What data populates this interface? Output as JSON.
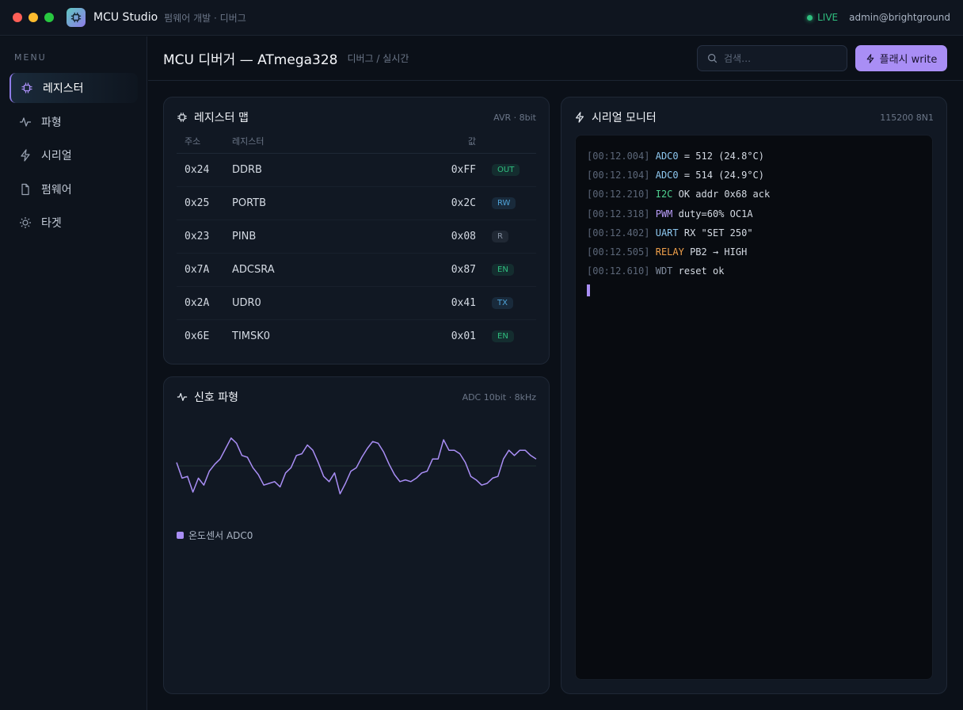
{
  "window": {
    "app_name": "MCU Studio",
    "app_subtitle": "펌웨어 개발 · 디버그",
    "live_label": "LIVE",
    "user": "admin@brightground"
  },
  "sidebar": {
    "menu_label": "MENU",
    "items": [
      {
        "label": "레지스터",
        "icon": "chip-icon",
        "active": true
      },
      {
        "label": "파형",
        "icon": "waveform-icon",
        "active": false
      },
      {
        "label": "시리얼",
        "icon": "lightning-icon",
        "active": false
      },
      {
        "label": "펌웨어",
        "icon": "file-icon",
        "active": false
      },
      {
        "label": "타겟",
        "icon": "sun-icon",
        "active": false
      }
    ]
  },
  "header": {
    "title": "MCU 디버거 — ATmega328",
    "breadcrumb": "디버그 / 실시간",
    "search_placeholder": "검색…",
    "flash_label": "플래시 write"
  },
  "registers": {
    "title": "레지스터 맵",
    "meta": "AVR · 8bit",
    "columns": [
      "주소",
      "레지스터",
      "값"
    ],
    "rows": [
      {
        "addr": "0x24",
        "name": "DDRB",
        "value": "0xFF",
        "badge": "OUT",
        "badge_color": "#2fbf7f"
      },
      {
        "addr": "0x25",
        "name": "PORTB",
        "value": "0x2C",
        "badge": "RW",
        "badge_color": "#4fa3d8"
      },
      {
        "addr": "0x23",
        "name": "PINB",
        "value": "0x08",
        "badge": "R",
        "badge_color": "#8a94a6"
      },
      {
        "addr": "0x7A",
        "name": "ADCSRA",
        "value": "0x87",
        "badge": "EN",
        "badge_color": "#2fbf7f"
      },
      {
        "addr": "0x2A",
        "name": "UDR0",
        "value": "0x41",
        "badge": "TX",
        "badge_color": "#4fa3d8"
      },
      {
        "addr": "0x6E",
        "name": "TIMSK0",
        "value": "0x01",
        "badge": "EN",
        "badge_color": "#2fbf7f"
      }
    ]
  },
  "waveform": {
    "title": "신호 파형",
    "meta": "ADC 10bit · 8kHz",
    "legend": "온도센서 ADC0",
    "color": "#a98ef5"
  },
  "chart_data": {
    "type": "line",
    "series": [
      {
        "name": "온도센서 ADC0",
        "values": [
          0.1,
          -0.35,
          -0.3,
          -0.75,
          -0.35,
          -0.55,
          -0.15,
          0.05,
          0.2,
          0.5,
          0.8,
          0.65,
          0.3,
          0.25,
          -0.05,
          -0.25,
          -0.55,
          -0.5,
          -0.45,
          -0.6,
          -0.2,
          -0.05,
          0.3,
          0.35,
          0.6,
          0.45,
          0.1,
          -0.3,
          -0.45,
          -0.2,
          -0.8,
          -0.5,
          -0.15,
          -0.05,
          0.25,
          0.5,
          0.7,
          0.65,
          0.4,
          0.05,
          -0.25,
          -0.45,
          -0.4,
          -0.45,
          -0.35,
          -0.2,
          -0.15,
          0.2,
          0.2,
          0.75,
          0.45,
          0.45,
          0.35,
          0.1,
          -0.3,
          -0.4,
          -0.55,
          -0.5,
          -0.35,
          -0.3,
          0.2,
          0.45,
          0.3,
          0.45,
          0.45,
          0.3,
          0.2
        ]
      }
    ],
    "grid": false,
    "legend_position": "bottom-left"
  },
  "serial": {
    "title": "시리얼 모니터",
    "meta": "115200 8N1",
    "lines": [
      {
        "ts": "[00:12.004]",
        "tag": "ADC0",
        "tag_color": "#8ec8f0",
        "msg": " = 512 (24.8°C)"
      },
      {
        "ts": "[00:12.104]",
        "tag": "ADC0",
        "tag_color": "#8ec8f0",
        "msg": " = 514 (24.9°C)"
      },
      {
        "ts": "[00:12.210]",
        "tag": "I2C",
        "tag_color": "#4fd18f",
        "msg": " OK addr 0x68 ack"
      },
      {
        "ts": "[00:12.318]",
        "tag": "PWM",
        "tag_color": "#b79cf7",
        "msg": " duty=60% OC1A"
      },
      {
        "ts": "[00:12.402]",
        "tag": "UART",
        "tag_color": "#8ec8f0",
        "msg": " RX \"SET 250\""
      },
      {
        "ts": "[00:12.505]",
        "tag": "RELAY",
        "tag_color": "#f0a04b",
        "msg": " PB2 → HIGH"
      },
      {
        "ts": "[00:12.610]",
        "tag": "WDT",
        "tag_color": "#7f8a9c",
        "msg": " reset ok"
      }
    ]
  },
  "colors": {
    "accent": "#a98ef5",
    "live": "#2fbf7f",
    "bg": "#0b1018"
  }
}
